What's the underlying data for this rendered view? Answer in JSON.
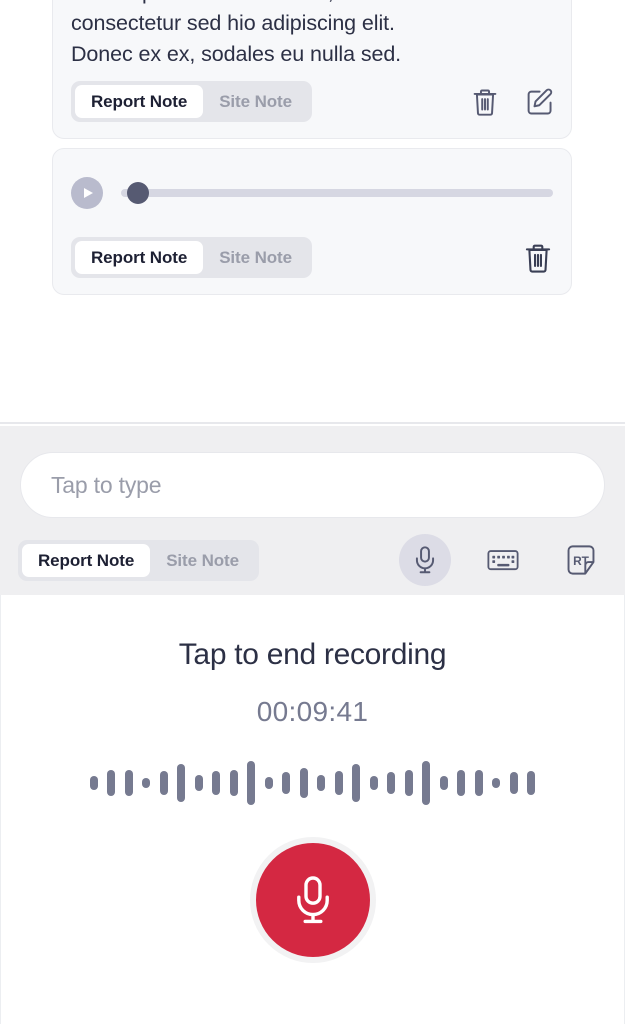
{
  "notes": [
    {
      "type": "text",
      "body": "Lorem ipsum dolor sit amet,\nconsectetur sed hio adipiscing elit.\nDonec ex ex, sodales eu nulla sed.",
      "tabs": [
        {
          "label": "Report Note",
          "active": true
        },
        {
          "label": "Site Note",
          "active": false
        }
      ],
      "actions": [
        "trash-icon",
        "edit-icon"
      ]
    },
    {
      "type": "audio",
      "play_icon": "play-icon",
      "progress_percent": 0,
      "tabs": [
        {
          "label": "Report Note",
          "active": true
        },
        {
          "label": "Site Note",
          "active": false
        }
      ],
      "actions": [
        "trash-icon"
      ]
    }
  ],
  "composer": {
    "input": {
      "value": "",
      "placeholder": "Tap to type"
    },
    "tabs": [
      {
        "label": "Report Note",
        "active": true
      },
      {
        "label": "Site Note",
        "active": false
      }
    ],
    "actions": [
      {
        "icon": "microphone-icon",
        "active": true
      },
      {
        "icon": "keyboard-icon",
        "active": false
      },
      {
        "icon": "rt-template-icon",
        "label": "RT",
        "active": false
      }
    ]
  },
  "recording": {
    "title": "Tap to end recording",
    "timer": "00:09:41",
    "record_button_icon": "microphone-icon",
    "accent_color": "#d42842",
    "waveform": [
      14,
      26,
      26,
      10,
      24,
      38,
      16,
      24,
      26,
      44,
      12,
      22,
      30,
      16,
      24,
      38,
      14,
      22,
      26,
      44,
      14,
      26,
      26,
      10,
      22,
      24
    ]
  },
  "colors": {
    "accent_red": "#d42842",
    "text_primary": "#2c3045",
    "text_muted": "#767a90",
    "tab_inactive": "#9a9daa",
    "surface": "#f7f8fa",
    "composer_bg": "#efeff1"
  }
}
